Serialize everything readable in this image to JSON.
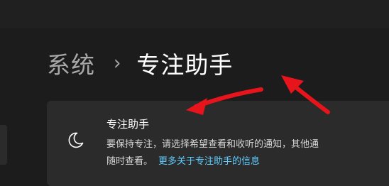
{
  "breadcrumb": {
    "parent": "系统",
    "separator": "›",
    "current": "专注助手"
  },
  "card": {
    "icon": "moon-icon",
    "title": "专注助手",
    "description_line1": "要保持专注，请选择希望查看和收听的通知，其他通",
    "description_line2": "随时查看。",
    "link": "更多关于专注助手的信息"
  },
  "colors": {
    "background": "#1c1c1c",
    "card": "#2b2b2b",
    "link": "#60cdff",
    "annotation_arrow": "#e8141c"
  }
}
